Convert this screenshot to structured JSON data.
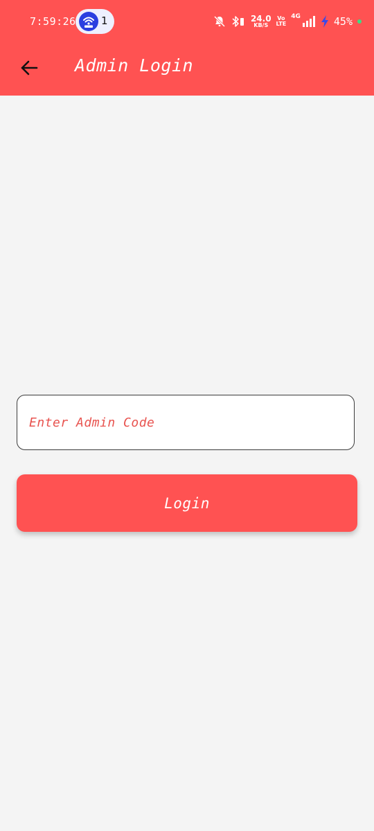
{
  "colors": {
    "accent": "#ff5252",
    "background": "#f4f4f4",
    "placeholder": "#e8534f",
    "field_border": "#3a3a3a"
  },
  "status_bar": {
    "time": "7:59:26",
    "hotspot_count": "1",
    "hotspot_icon": "wifi-hotspot-icon",
    "net_speed": "24.0",
    "net_speed_unit": "KB/S",
    "volte_top": "Vo",
    "volte_bottom": "LTE",
    "network_type": "4G",
    "battery_percent": "45%",
    "icons": [
      "mute-bell-icon",
      "bluetooth-icon",
      "signal-icon",
      "charging-bolt-icon"
    ]
  },
  "app_bar": {
    "back_icon": "arrow-left-icon",
    "title": "Admin Login"
  },
  "form": {
    "code_input": {
      "value": "",
      "placeholder": "Enter Admin Code"
    },
    "login_label": "Login"
  }
}
